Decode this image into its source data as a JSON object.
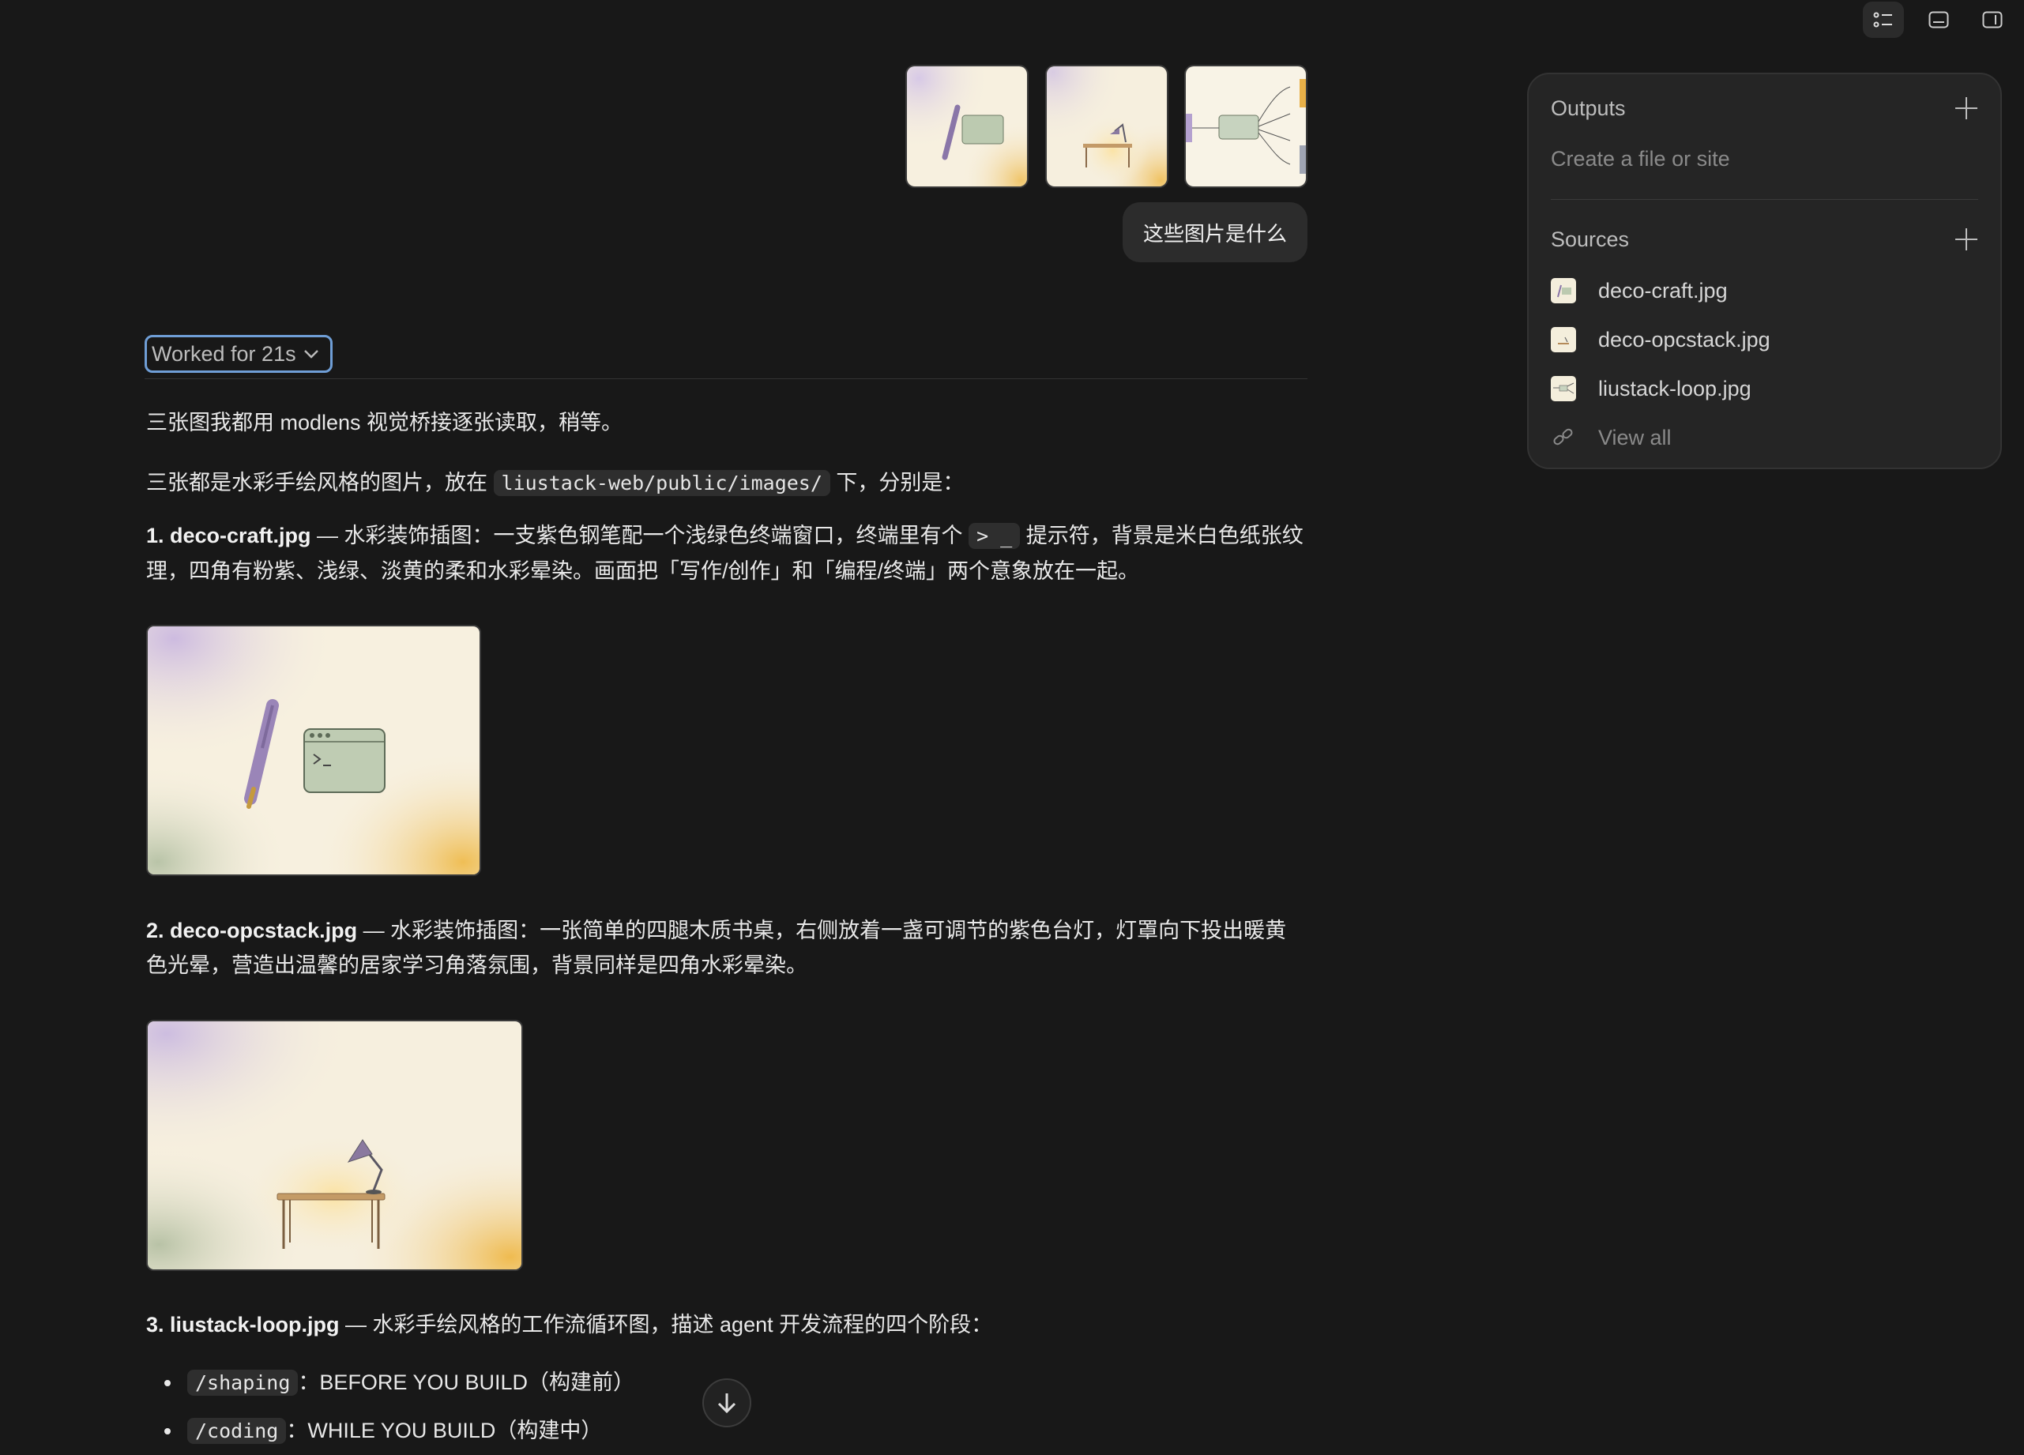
{
  "toolbar": {
    "icons": [
      "list-panel-icon",
      "bottom-panel-icon",
      "right-panel-icon"
    ]
  },
  "user_message": {
    "attachments": [
      "deco-craft thumbnail",
      "deco-opcstack thumbnail",
      "liustack-loop thumbnail"
    ],
    "text": "这些图片是什么"
  },
  "assistant": {
    "worked_label": "Worked for 21s",
    "p1": "三张图我都用 modlens 视觉桥接逐张读取，稍等。",
    "p2_pre": "三张都是水彩手绘风格的图片，放在 ",
    "p2_code": "liustack-web/public/images/",
    "p2_post": " 下，分别是：",
    "item1_title": "1. deco-craft.jpg",
    "item1_pre": " — 水彩装饰插图：一支紫色钢笔配一个浅绿色终端窗口，终端里有个 ",
    "item1_code": "> _",
    "item1_post": " 提示符，背景是米白色纸张纹理，四角有粉紫、浅绿、淡黄的柔和水彩晕染。画面把「写作/创作」和「编程/终端」两个意象放在一起。",
    "item2_title": "2. deco-opcstack.jpg",
    "item2_text": " — 水彩装饰插图：一张简单的四腿木质书桌，右侧放着一盏可调节的紫色台灯，灯罩向下投出暖黄色光晕，营造出温馨的居家学习角落氛围，背景同样是四角水彩晕染。",
    "item3_title": "3. liustack-loop.jpg",
    "item3_text": " — 水彩手绘风格的工作流循环图，描述 agent 开发流程的四个阶段：",
    "bullets": [
      {
        "code": "/shaping",
        "text": "：BEFORE YOU BUILD（构建前）"
      },
      {
        "code": "/coding",
        "text": "：WHILE YOU BUILD（构建中）"
      }
    ]
  },
  "panel": {
    "outputs_title": "Outputs",
    "outputs_placeholder": "Create a file or site",
    "sources_title": "Sources",
    "sources": [
      "deco-craft.jpg",
      "deco-opcstack.jpg",
      "liustack-loop.jpg"
    ],
    "view_all": "View all"
  },
  "colors": {
    "background": "#181818",
    "panel": "#252525",
    "focus_ring": "#6f9ed6"
  }
}
